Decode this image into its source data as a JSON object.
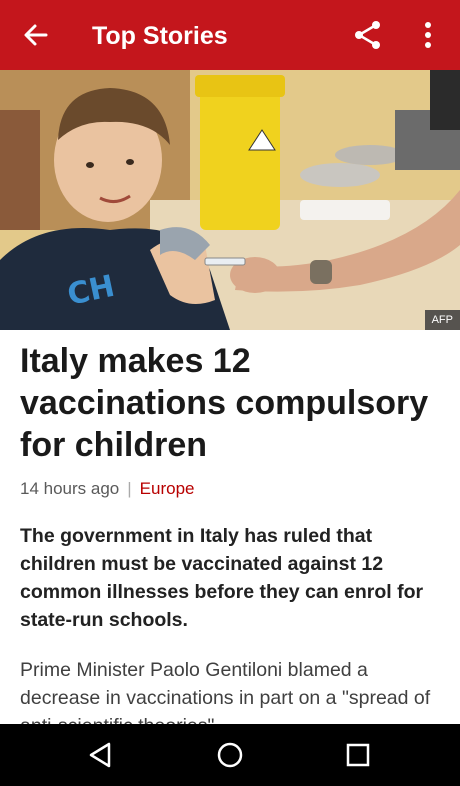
{
  "appbar": {
    "title": "Top Stories",
    "back_icon": "arrow-back-icon",
    "share_icon": "share-icon",
    "more_icon": "more-vert-icon",
    "color": "#c4161c"
  },
  "hero": {
    "credit": "AFP",
    "alt": "A boy receiving a vaccination injection in his upper arm"
  },
  "article": {
    "headline": "Italy makes 12 vaccinations compulsory for children",
    "timestamp": "14 hours ago",
    "separator": "|",
    "section": "Europe",
    "summary": "The government in Italy has ruled that children must be vaccinated against 12 common illnesses before they can enrol for state-run schools.",
    "body": "Prime Minister Paolo Gentiloni blamed a decrease in vaccinations in part on a \"spread of anti-scientific theories\"."
  },
  "navbar": {
    "back_icon": "nav-back-triangle-icon",
    "home_icon": "nav-home-circle-icon",
    "recents_icon": "nav-recents-square-icon"
  }
}
